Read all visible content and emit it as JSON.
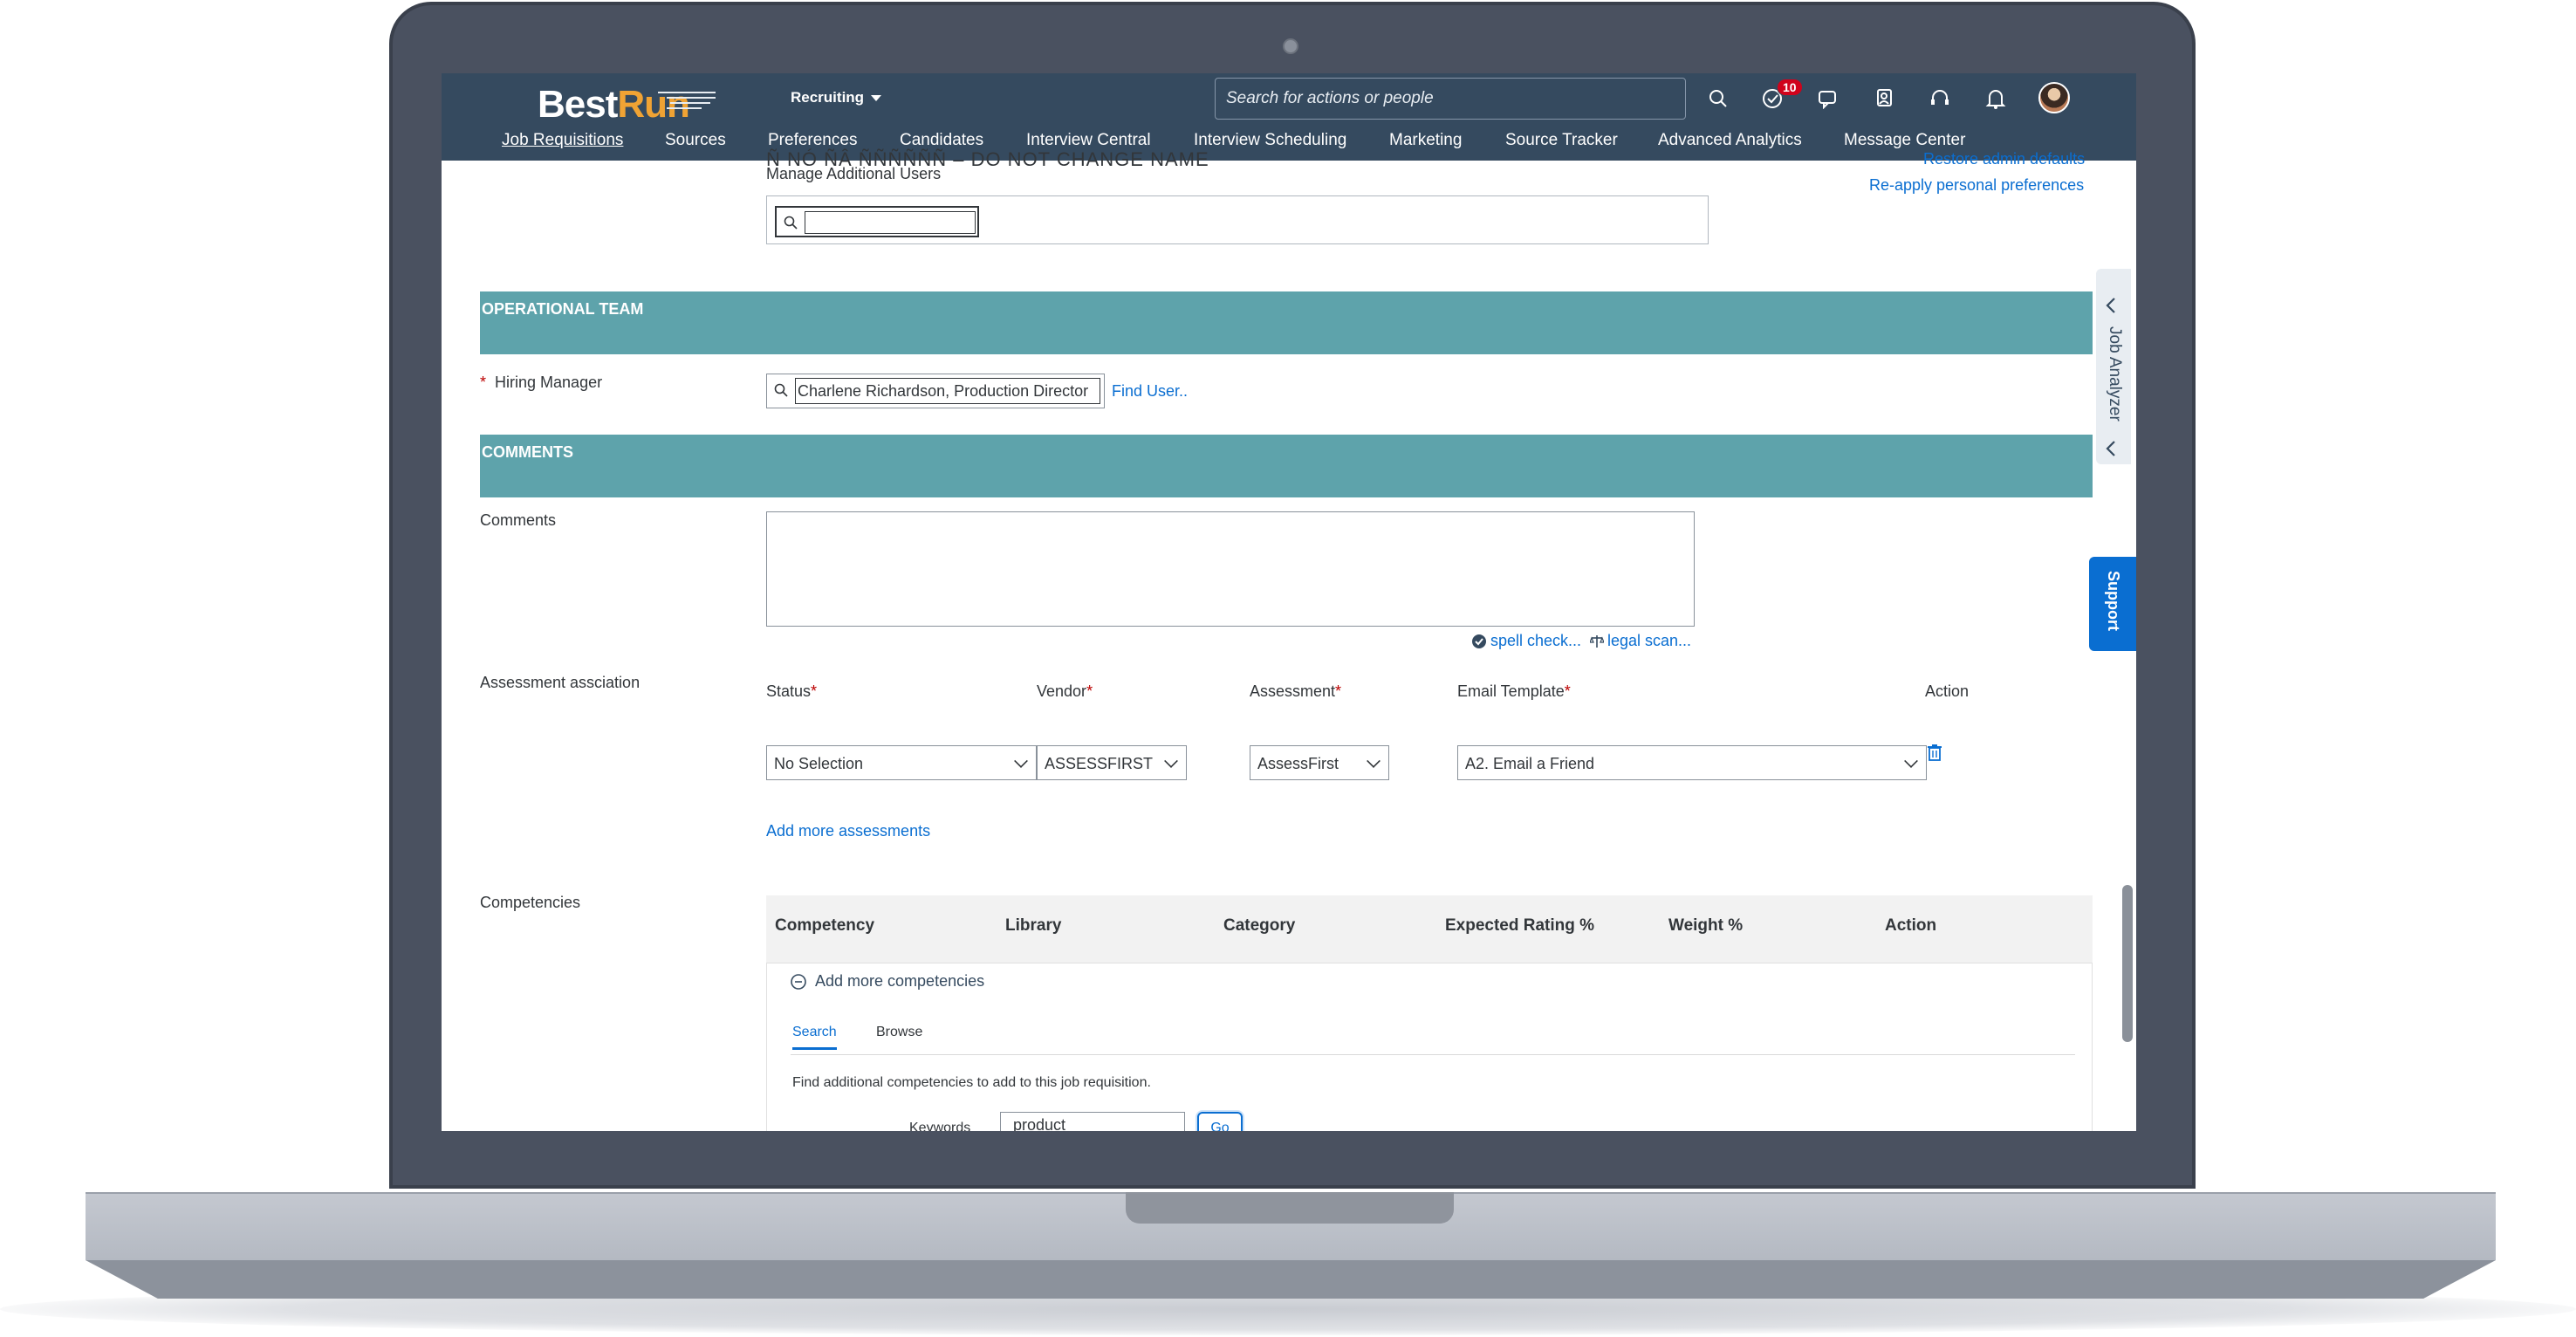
{
  "shell": {
    "logo_best": "Best",
    "logo_run": "Run",
    "module": "Recruiting",
    "search_placeholder": "Search for actions or people",
    "notification_count": "10",
    "nav": [
      "Job Requisitions",
      "Sources",
      "Preferences",
      "Candidates",
      "Interview Central",
      "Interview Scheduling",
      "Marketing",
      "Source Tracker",
      "Advanced Analytics",
      "Message Center"
    ]
  },
  "top": {
    "cut_text": "Ñ NÓ ÑÂ ÑÑÑÑÑÑ – DO NOT CHANGE NAME",
    "manage_users": "Manage Additional Users",
    "restore_defaults": "Restore admin defaults",
    "reapply": "Re-apply personal preferences"
  },
  "operational": {
    "title": "OPERATIONAL TEAM",
    "hiring_manager_label": "Hiring Manager",
    "required_mark": "*",
    "hiring_manager_value": "Charlene Richardson, Production Director",
    "find_user": "Find User.."
  },
  "comments": {
    "title": "COMMENTS",
    "label": "Comments",
    "spell_check": "spell check...",
    "legal_scan": "legal scan..."
  },
  "assessment": {
    "label": "Assessment assciation",
    "headers": {
      "status": "Status",
      "vendor": "Vendor",
      "assessment": "Assessment",
      "email": "Email Template",
      "action": "Action"
    },
    "req": "*",
    "status_value": "No Selection",
    "vendor_value": "ASSESSFIRST",
    "assessment_value": "AssessFirst",
    "email_value": "A2. Email a Friend",
    "add_more": "Add more assessments"
  },
  "competencies": {
    "label": "Competencies",
    "columns": [
      "Competency",
      "Library",
      "Category",
      "Expected Rating %",
      "Weight %",
      "Action"
    ],
    "add_more": "Add more competencies",
    "tabs": [
      "Search",
      "Browse"
    ],
    "find_text": "Find additional competencies to add to this job requisition.",
    "keywords_label": "Keywords",
    "keywords_value": "product",
    "go": "Go"
  },
  "side": {
    "job_analyzer": "Job Analyzer",
    "support": "Support"
  }
}
